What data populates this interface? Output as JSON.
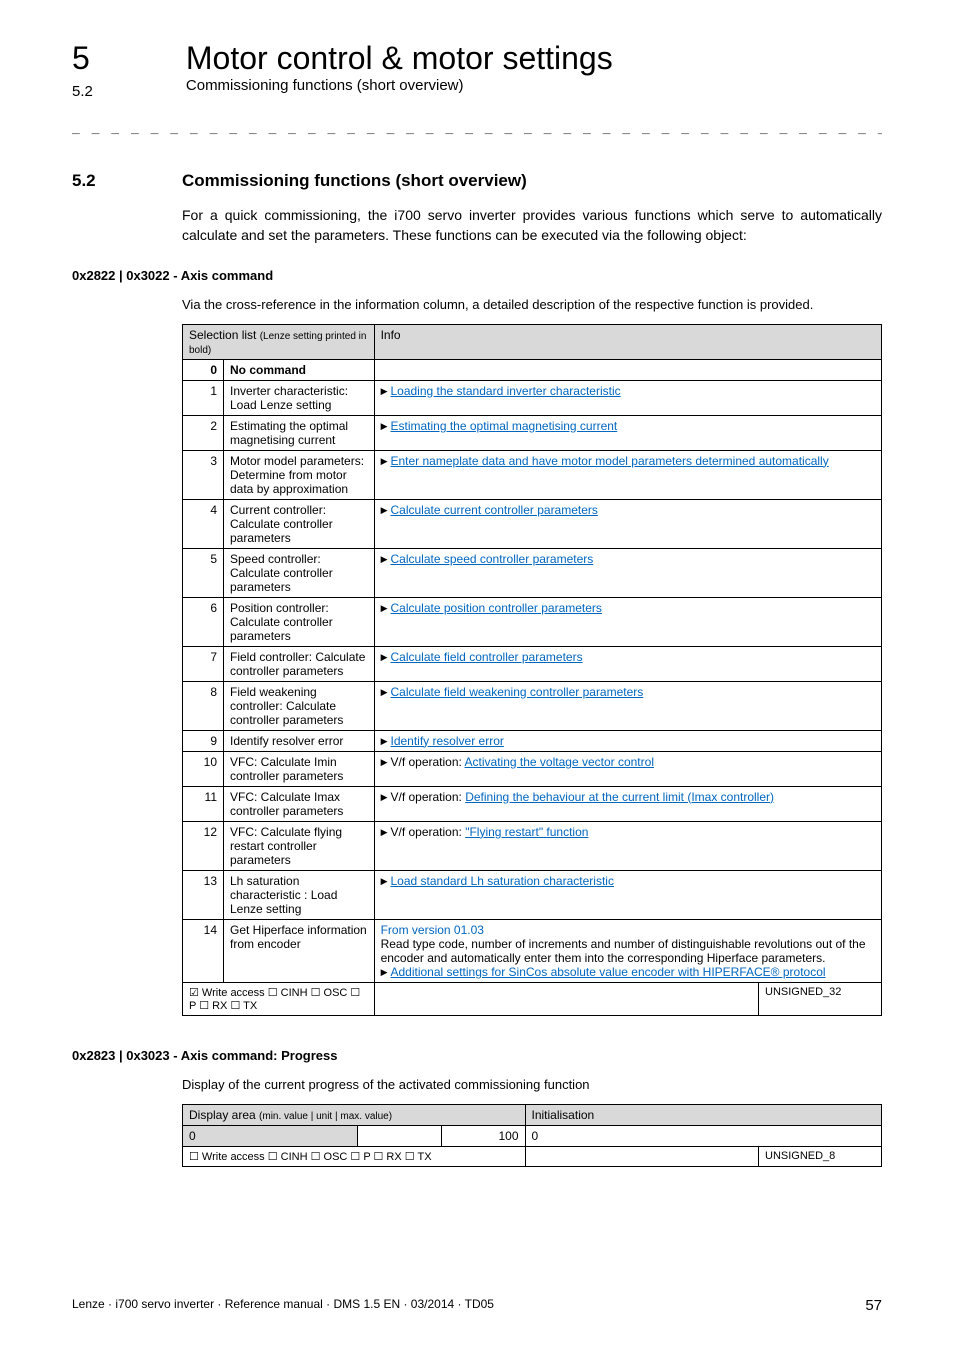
{
  "header": {
    "chapter_num": "5",
    "chapter_title": "Motor control & motor settings",
    "sub_num": "5.2",
    "sub_title": "Commissioning functions (short overview)",
    "dashes": "_ _ _ _ _ _ _ _ _ _ _ _ _ _ _ _ _ _ _ _ _ _ _ _ _ _ _ _ _ _ _ _ _ _ _ _ _ _ _ _ _ _ _ _ _ _ _ _ _ _ _ _ _ _ _ _ _ _ _ _ _ _ _ _"
  },
  "section": {
    "num": "5.2",
    "title": "Commissioning functions (short overview)",
    "intro": "For a quick commissioning, the i700 servo inverter provides various functions which serve to automatically calculate and set the parameters. These functions can be executed via the following object:"
  },
  "table1": {
    "heading": "0x2822 | 0x3022 - Axis command",
    "note": "Via the cross-reference in the information column, a detailed description of the respective function is provided.",
    "col1": "Selection list ",
    "col1_paren": "(Lenze setting printed in bold)",
    "col2": "Info",
    "rows": [
      {
        "n": "0",
        "desc": "No command",
        "bold": true,
        "info_pre": "",
        "info_link": "",
        "info_post": ""
      },
      {
        "n": "1",
        "desc": "Inverter characteristic: Load Lenze setting",
        "info_pre": "",
        "info_link": "Loading the standard inverter characteristic",
        "info_post": ""
      },
      {
        "n": "2",
        "desc": "Estimating the optimal magnetising current",
        "info_pre": "",
        "info_link": "Estimating the optimal magnetising current",
        "info_post": ""
      },
      {
        "n": "3",
        "desc": "Motor model parameters: Determine from motor data by approximation",
        "info_pre": "",
        "info_link": "Enter nameplate data and have motor model parameters determined automatically",
        "info_post": ""
      },
      {
        "n": "4",
        "desc": "Current controller: Calculate controller parameters",
        "info_pre": "",
        "info_link": "Calculate current controller parameters",
        "info_post": ""
      },
      {
        "n": "5",
        "desc": "Speed controller: Calculate controller parameters",
        "info_pre": "",
        "info_link": "Calculate speed controller parameters",
        "info_post": ""
      },
      {
        "n": "6",
        "desc": "Position controller: Calculate controller parameters",
        "info_pre": "",
        "info_link": "Calculate position controller parameters",
        "info_post": ""
      },
      {
        "n": "7",
        "desc": "Field controller: Calculate controller parameters",
        "info_pre": "",
        "info_link": "Calculate field controller parameters",
        "info_post": ""
      },
      {
        "n": "8",
        "desc": "Field weakening controller: Calculate controller parameters",
        "info_pre": "",
        "info_link": "Calculate field weakening controller parameters",
        "info_post": ""
      },
      {
        "n": "9",
        "desc": "Identify resolver error",
        "info_pre": "",
        "info_link": "Identify resolver error",
        "info_post": ""
      },
      {
        "n": "10",
        "desc": "VFC: Calculate Imin controller parameters",
        "info_pre": "V/f operation: ",
        "info_link": "Activating the voltage vector control",
        "info_post": ""
      },
      {
        "n": "11",
        "desc": "VFC: Calculate Imax controller parameters",
        "info_pre": "V/f operation: ",
        "info_link": "Defining the behaviour at the current limit (Imax controller)",
        "info_post": ""
      },
      {
        "n": "12",
        "desc": "VFC: Calculate flying restart controller parameters",
        "info_pre": "V/f operation: ",
        "info_link": "\"Flying restart\" function",
        "info_post": ""
      },
      {
        "n": "13",
        "desc": "Lh saturation characteristic : Load Lenze setting",
        "info_pre": "",
        "info_link": "Load standard Lh saturation characteristic",
        "info_post": ""
      }
    ],
    "row14": {
      "n": "14",
      "desc": "Get Hiperface information from encoder",
      "line1": "From version 01.03",
      "line2": "Read type code, number of increments and number of distinguishable revolutions out of the encoder and automatically enter them into the corresponding Hiperface parameters.",
      "link1": "Additional settings for SinCos absolute value encoder with HIPERFACE® protocol"
    },
    "footer_left": "☑ Write access   ☐ CINH   ☐ OSC   ☐ P   ☐ RX   ☐ TX",
    "footer_right": "UNSIGNED_32"
  },
  "table2": {
    "heading": "0x2823 | 0x3023 - Axis command: Progress",
    "note": "Display of the current progress of the activated commissioning function",
    "col1": "Display area ",
    "col1_paren": "(min. value | unit | max. value)",
    "col2": "Initialisation",
    "min": "0",
    "max": "100",
    "init": "0",
    "footer_left": "☐ Write access   ☐ CINH   ☐ OSC   ☐ P   ☐ RX   ☐ TX",
    "footer_right": "UNSIGNED_8"
  },
  "footer": {
    "left": "Lenze · i700 servo inverter · Reference manual · DMS 1.5 EN · 03/2014 · TD05",
    "right": "57"
  }
}
